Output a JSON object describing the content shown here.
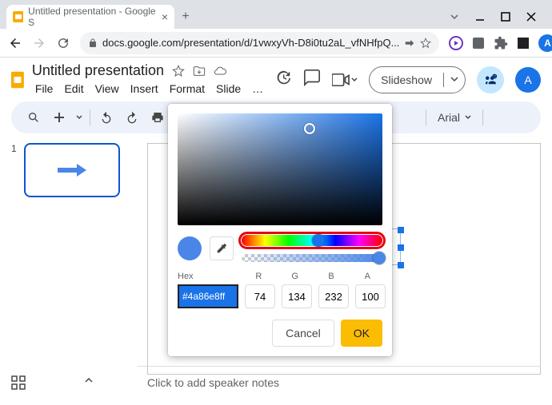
{
  "browser": {
    "tab_title": "Untitled presentation - Google S",
    "url": "docs.google.com/presentation/d/1vwxyVh-D8i0tu2aL_vfNHfpQ...",
    "avatar_letter": "A"
  },
  "app": {
    "doc_title": "Untitled presentation",
    "menus": [
      "File",
      "Edit",
      "View",
      "Insert",
      "Format",
      "Slide",
      "…"
    ],
    "slideshow_label": "Slideshow",
    "avatar_letter": "A"
  },
  "toolbar": {
    "font": "Arial"
  },
  "thumb": {
    "number": "1"
  },
  "notes": {
    "placeholder": "Click to add speaker notes"
  },
  "picker": {
    "hex_label": "Hex",
    "r_label": "R",
    "g_label": "G",
    "b_label": "B",
    "a_label": "A",
    "hex": "#4a86e8ff",
    "r": "74",
    "g": "134",
    "b": "232",
    "a": "100",
    "cancel": "Cancel",
    "ok": "OK"
  }
}
